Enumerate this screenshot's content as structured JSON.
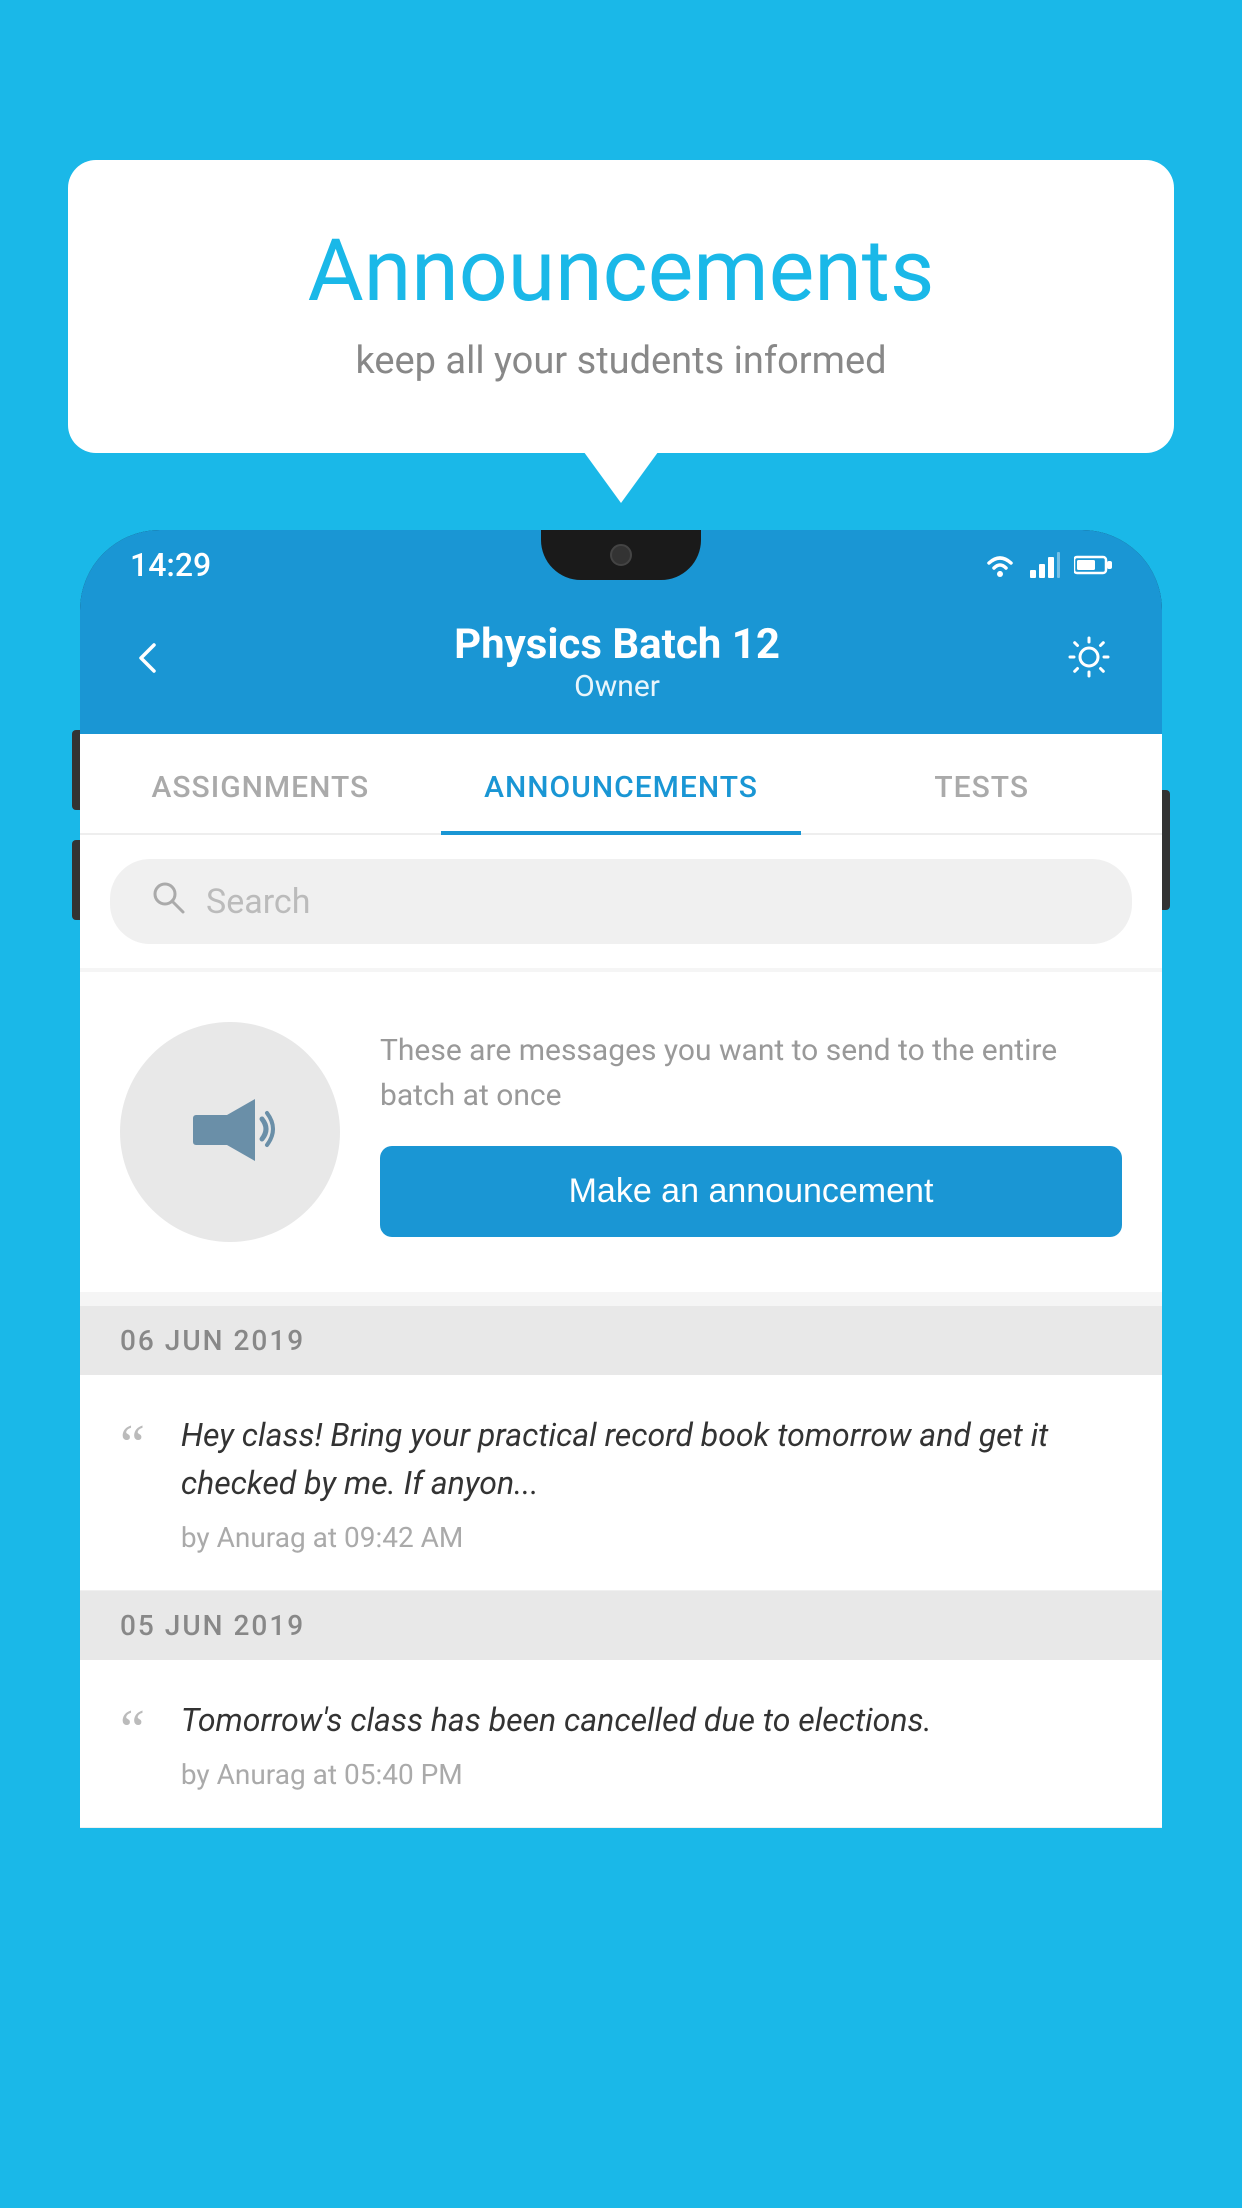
{
  "page": {
    "background_color": "#1ab8e8"
  },
  "speech_bubble": {
    "title": "Announcements",
    "subtitle": "keep all your students informed",
    "title_color": "#1ab8e8"
  },
  "status_bar": {
    "time": "14:29",
    "background_color": "#1a96d4"
  },
  "app_header": {
    "title": "Physics Batch 12",
    "subtitle": "Owner",
    "background_color": "#1a96d4"
  },
  "tabs": [
    {
      "label": "ASSIGNMENTS",
      "active": false
    },
    {
      "label": "ANNOUNCEMENTS",
      "active": true
    },
    {
      "label": "TESTS",
      "active": false
    }
  ],
  "search": {
    "placeholder": "Search"
  },
  "cta_section": {
    "description": "These are messages you want to send to the entire batch at once",
    "button_label": "Make an announcement"
  },
  "announcements": [
    {
      "date": "06  JUN  2019",
      "text": "Hey class! Bring your practical record book tomorrow and get it checked by me. If anyon...",
      "meta": "by Anurag at 09:42 AM"
    },
    {
      "date": "05  JUN  2019",
      "text": "Tomorrow's class has been cancelled due to elections.",
      "meta": "by Anurag at 05:40 PM"
    }
  ]
}
